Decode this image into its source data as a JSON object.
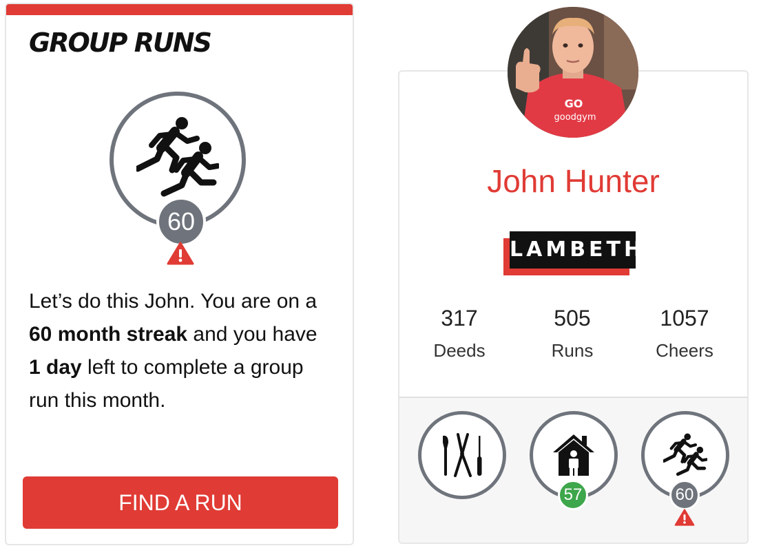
{
  "group_runs": {
    "title": "GROUP RUNS",
    "badge_count": "60",
    "text_intro": "Let’s do this John. You are on a ",
    "streak_bold": "60 month streak",
    "text_mid": " and you have ",
    "days_bold": "1 day",
    "text_end": " left to complete a group run this month.",
    "button_label": "FIND A RUN"
  },
  "profile": {
    "name": "John Hunter",
    "area": "LAMBETH",
    "stats": [
      {
        "value": "317",
        "label": "Deeds"
      },
      {
        "value": "505",
        "label": "Runs"
      },
      {
        "value": "1057",
        "label": "Cheers"
      }
    ],
    "badges": [
      {
        "icon": "garden-tools-icon",
        "count": null
      },
      {
        "icon": "house-person-icon",
        "count": "57",
        "count_color": "#3ea64b"
      },
      {
        "icon": "runners-icon",
        "count": "60",
        "count_color": "#6f747c",
        "warning": true
      }
    ]
  },
  "colors": {
    "accent_red": "#e03b35",
    "badge_grey": "#6f747c",
    "success_green": "#3ea64b"
  }
}
